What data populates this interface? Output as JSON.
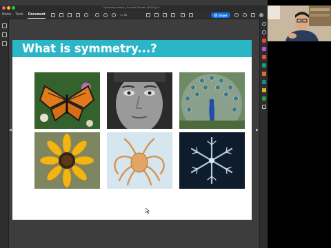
{
  "window": {
    "title": "Symmetry basics | Acrobat Reader (2023).pdf"
  },
  "toolbar": {
    "tabs": [
      "Home",
      "Tools",
      "Document"
    ],
    "active_tab": "Document",
    "page_indicator": "1 / 30",
    "share_label": "Share"
  },
  "slide": {
    "title": "What is symmetry...?",
    "images": [
      {
        "subject": "monarch butterfly on flowers"
      },
      {
        "subject": "human face"
      },
      {
        "subject": "peacock with fanned tail"
      },
      {
        "subject": "yellow sunflower"
      },
      {
        "subject": "spider crab"
      },
      {
        "subject": "snowflake"
      }
    ]
  },
  "colors": {
    "title_band": "#2bb6c8",
    "share_button": "#1473e6",
    "app_background": "#3a3a3a",
    "slide_background": "#ffffff"
  },
  "icons": {
    "toolbar": [
      "add-icon",
      "star-icon",
      "share-icon",
      "print-icon",
      "search-icon",
      "zoom-out-icon",
      "zoom-in-icon",
      "hand-icon",
      "cursor-icon",
      "comment-icon",
      "pen-icon",
      "sign-icon",
      "help-icon",
      "bell-icon",
      "grid-icon",
      "account-icon"
    ],
    "left_rail": [
      "bookmark-icon",
      "page-icon",
      "attachment-icon"
    ],
    "right_rail": [
      "search-icon",
      "zoom-icon",
      "edit-pdf-icon",
      "export-icon",
      "create-pdf-icon",
      "comment-icon",
      "combine-icon",
      "organize-icon",
      "protect-icon",
      "scan-icon",
      "more-tools-icon"
    ]
  }
}
